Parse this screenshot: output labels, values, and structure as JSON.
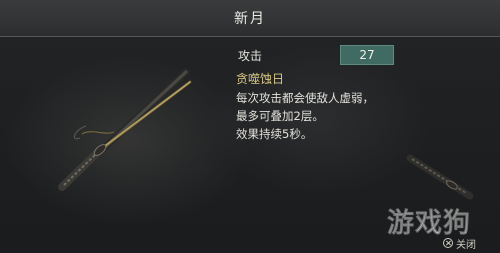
{
  "title": "新月",
  "stats": {
    "attack_label": "攻击",
    "attack_value": "27"
  },
  "skill": {
    "name": "贪噬蚀日",
    "lines": [
      "每次攻击都会使敌人虚弱，",
      "最多可叠加2层。",
      "效果持续5秒。"
    ]
  },
  "footer": {
    "close_label": "关闭",
    "close_icon": "cross-button-icon"
  },
  "watermark": "游戏狗",
  "colors": {
    "stat_box": "#3f6b62",
    "skill_name": "#d9c785"
  },
  "icons": {
    "weapon_main": "katana-and-scabbard",
    "weapon_side": "katana-hilt"
  }
}
